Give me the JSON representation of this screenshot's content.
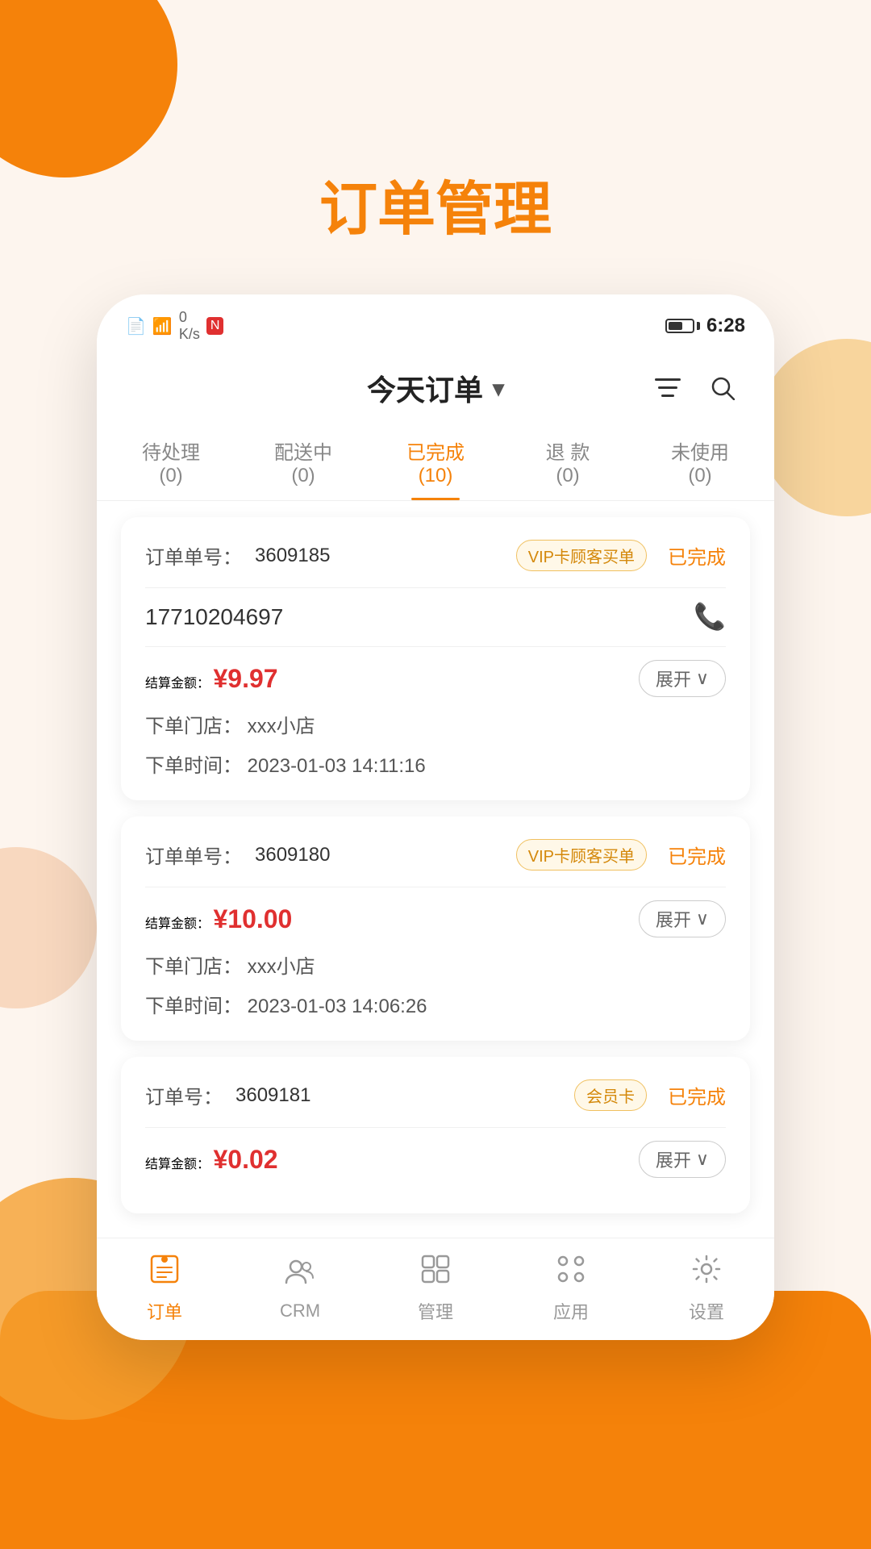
{
  "page": {
    "title": "订单管理",
    "background_color": "#fdf5ee",
    "accent_color": "#f5820a"
  },
  "status_bar": {
    "time": "6:28",
    "icons_left": [
      "sim",
      "wifi",
      "speed",
      "nfc"
    ]
  },
  "header": {
    "title": "今天订单",
    "dropdown_icon": "▾",
    "filter_icon": "≡",
    "search_icon": "🔍"
  },
  "tabs": [
    {
      "label": "待处理",
      "count": "(0)",
      "active": false
    },
    {
      "label": "配送中",
      "count": "(0)",
      "active": false
    },
    {
      "label": "已完成",
      "count": "(10)",
      "active": true
    },
    {
      "label": "退 款",
      "count": "(0)",
      "active": false
    },
    {
      "label": "未使用",
      "count": "(0)",
      "active": false
    }
  ],
  "orders": [
    {
      "id": "order-1",
      "number_label": "订单单号：",
      "number": "3609185",
      "tag": "VIP卡顾客买单",
      "tag_type": "vip",
      "status": "已完成",
      "phone": "17710204697",
      "amount_label": "结算金额：",
      "amount": "¥9.97",
      "expand_label": "展开",
      "store_label": "下单门店：",
      "store": "xxx小店",
      "time_label": "下单时间：",
      "time": "2023-01-03 14:11:16"
    },
    {
      "id": "order-2",
      "number_label": "订单单号：",
      "number": "3609180",
      "tag": "VIP卡顾客买单",
      "tag_type": "vip",
      "status": "已完成",
      "phone": null,
      "amount_label": "结算金额：",
      "amount": "¥10.00",
      "expand_label": "展开",
      "store_label": "下单门店：",
      "store": "xxx小店",
      "time_label": "下单时间：",
      "time": "2023-01-03 14:06:26"
    },
    {
      "id": "order-3",
      "number_label": "订单号：",
      "number": "3609181",
      "tag": "会员卡",
      "tag_type": "member",
      "status": "已完成",
      "phone": null,
      "amount_label": "结算金额：",
      "amount": "¥0.02",
      "expand_label": "展开",
      "store_label": null,
      "store": null,
      "time_label": null,
      "time": null
    }
  ],
  "bottom_nav": [
    {
      "icon": "📋",
      "label": "订单",
      "active": true
    },
    {
      "icon": "👥",
      "label": "CRM",
      "active": false
    },
    {
      "icon": "📊",
      "label": "管理",
      "active": false
    },
    {
      "icon": "⚙️",
      "label": "应用",
      "active": false
    },
    {
      "icon": "🔧",
      "label": "设置",
      "active": false
    }
  ]
}
